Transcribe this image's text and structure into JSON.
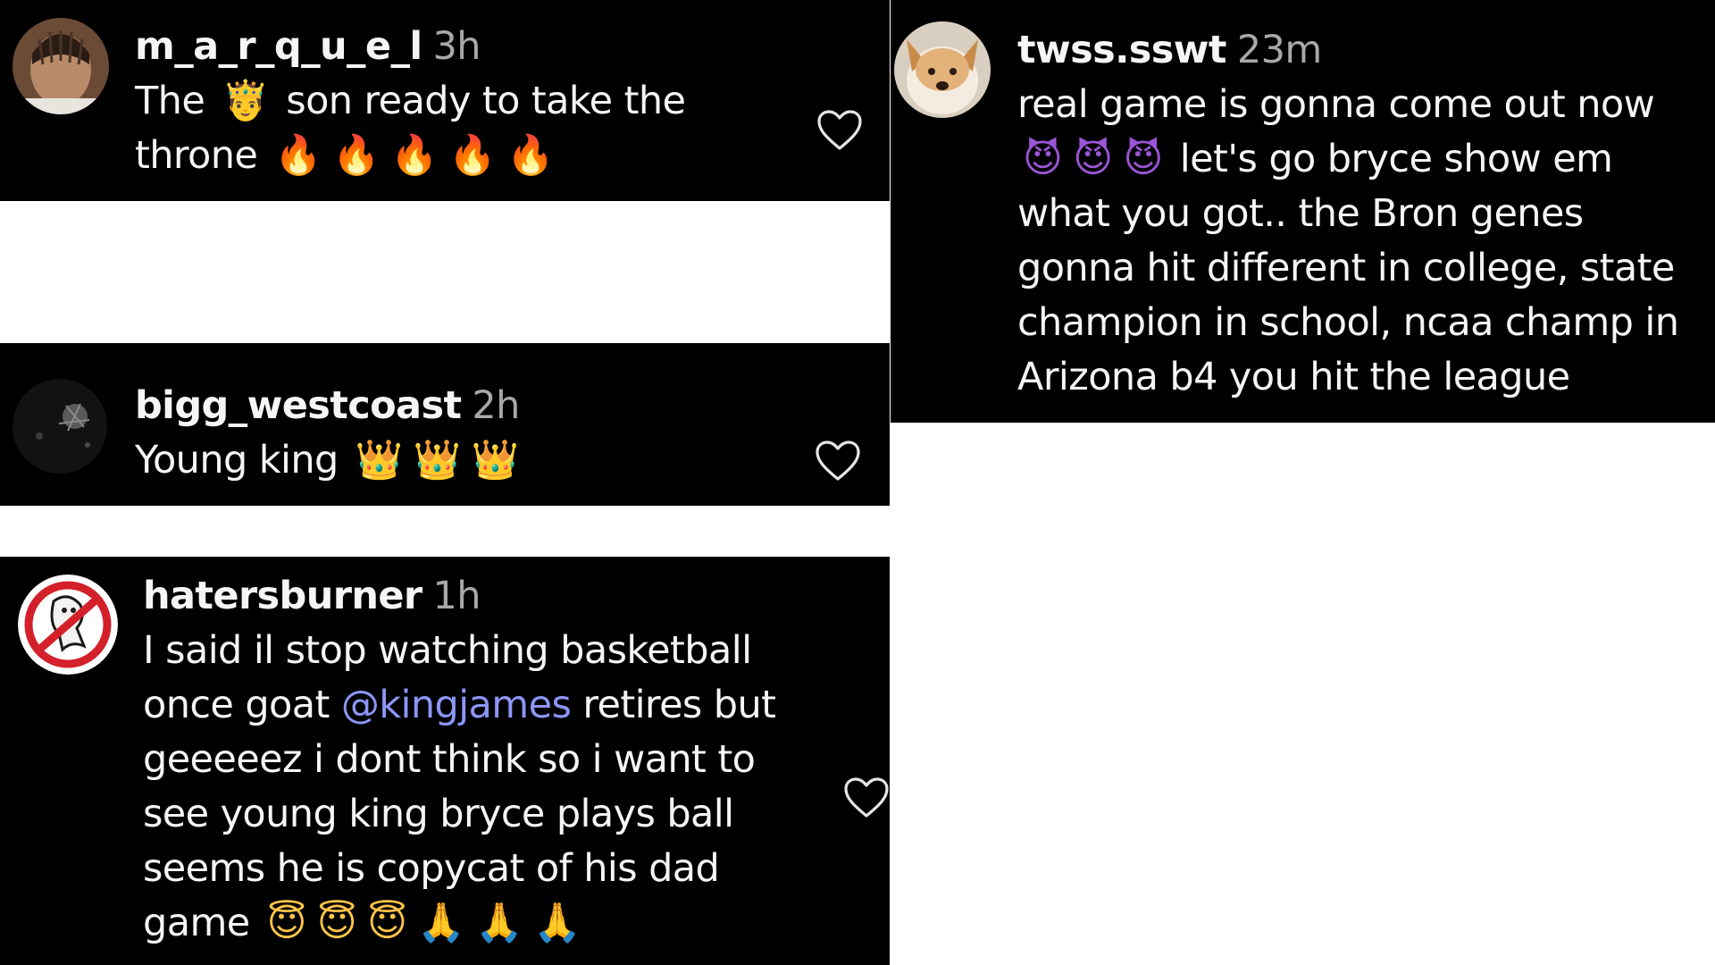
{
  "comments": [
    {
      "username": "m_a_r_q_u_e_l",
      "time": "3h",
      "lines": [
        [
          "The ",
          "🤴",
          " son ready to take the"
        ],
        [
          "throne ",
          "🔥",
          "🔥",
          "🔥",
          "🔥",
          "🔥"
        ]
      ],
      "emoji_names": [
        "prince-emoji",
        "fire-emoji"
      ]
    },
    {
      "username": "bigg_westcoast",
      "time": "2h",
      "text": "Young king",
      "emoji": [
        "👑",
        "👑",
        "👑"
      ]
    },
    {
      "username": "hatersburner",
      "time": "1h",
      "line1": "I said il stop watching basketball",
      "line2_pre": "once goat ",
      "mention": "@kingjames",
      "line2_post": " retires but",
      "line3": "geeeeez i dont think so i want to",
      "line4": "see young king bryce plays ball",
      "line5": "seems he is copycat of his dad",
      "line6_text": "game",
      "line6_emoji": [
        "😇",
        "😇",
        "😇",
        "🙏",
        "🙏",
        "🙏"
      ]
    },
    {
      "username": "twss.sswt",
      "time": "23m",
      "line1": "real game is gonna come out now",
      "line2_emoji": [
        "😈",
        "😈",
        "😈"
      ],
      "line2_text": "let's go bryce show em",
      "line3": "what you got.. the Bron genes",
      "line4": "gonna hit different in college, state",
      "line5": "champion in school, ncaa champ in",
      "line6": "Arizona b4 you hit the league"
    }
  ],
  "icons": {
    "like": "heart-outline-icon"
  },
  "colors": {
    "card_bg": "#000000",
    "page_bg": "#ffffff",
    "text": "#f5f5f5",
    "time": "#a8a8a8",
    "mention": "#8c96f5"
  }
}
